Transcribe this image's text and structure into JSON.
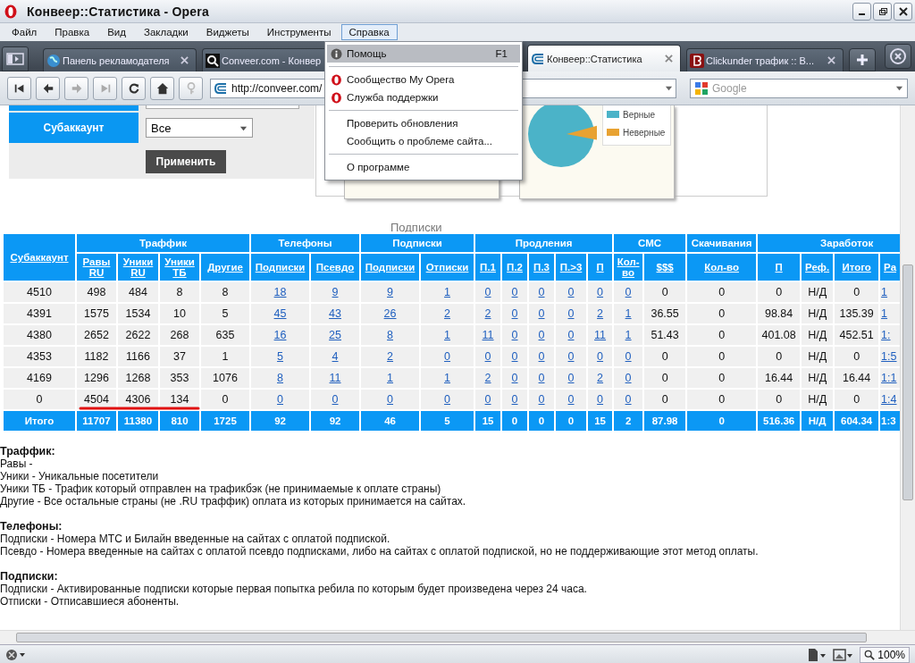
{
  "window": {
    "title": "Конвеер::Статистика - Opera"
  },
  "menu_bar": [
    {
      "label": "Файл",
      "selected": false
    },
    {
      "label": "Правка",
      "selected": false
    },
    {
      "label": "Вид",
      "selected": false
    },
    {
      "label": "Закладки",
      "selected": false
    },
    {
      "label": "Виджеты",
      "selected": false
    },
    {
      "label": "Инструменты",
      "selected": false
    },
    {
      "label": "Справка",
      "selected": true
    }
  ],
  "help_menu": [
    {
      "kind": "help",
      "label": "Помощь",
      "shortcut": "F1",
      "selected": true
    },
    {
      "kind": "separator"
    },
    {
      "kind": "opera",
      "label": "Сообщество My Opera",
      "selected": false
    },
    {
      "kind": "opera",
      "label": "Служба поддержки",
      "selected": false
    },
    {
      "kind": "separator"
    },
    {
      "kind": "plain",
      "label": "Проверить обновления",
      "selected": false
    },
    {
      "kind": "plain",
      "label": "Сообщить о проблеме сайта...",
      "selected": false
    },
    {
      "kind": "separator"
    },
    {
      "kind": "plain",
      "label": "О программе",
      "selected": false
    }
  ],
  "tabs": [
    {
      "label": "Панель рекламодателя",
      "selected": false,
      "close_button": true
    },
    {
      "label": "Conveer.com - Конвер",
      "selected": false
    },
    {
      "label": "Конвеер::Статистика",
      "selected": true,
      "close_button": true
    },
    {
      "label": "Clickunder трафик :: В...",
      "selected": false,
      "close_button": true
    }
  ],
  "address_bar": {
    "url": "http://conveer.com/"
  },
  "search": {
    "placeholder": "Google"
  },
  "filter_form": {
    "subaccount_label": "Субаккаунт",
    "subaccount_value": "Все",
    "apply_button": "Применить"
  },
  "charts": {
    "legend": [
      {
        "label": "Верные",
        "color": "#4bb3c8"
      },
      {
        "label": "Неверные",
        "color": "#e8a231"
      }
    ],
    "caption": "Подписки"
  },
  "table": {
    "key_column": "Субаккаунт",
    "groups": [
      {
        "label": "Траффик",
        "columns": [
          {
            "label": "Равы RU",
            "link": false
          },
          {
            "label": "Уники RU",
            "link": false
          },
          {
            "label": "Уники ТБ",
            "link": false
          },
          {
            "label": "Другие",
            "link": false
          }
        ]
      },
      {
        "label": "Телефоны",
        "columns": [
          {
            "label": "Подписки",
            "link": true
          },
          {
            "label": "Псевдо",
            "link": true
          }
        ]
      },
      {
        "label": "Подписки",
        "columns": [
          {
            "label": "Подписки",
            "link": true
          },
          {
            "label": "Отписки",
            "link": true
          }
        ]
      },
      {
        "label": "Продления",
        "columns": [
          {
            "label": "П.1",
            "link": true
          },
          {
            "label": "П.2",
            "link": true
          },
          {
            "label": "П.3",
            "link": true
          },
          {
            "label": "П.>3",
            "link": true
          },
          {
            "label": "П",
            "link": true
          }
        ]
      },
      {
        "label": "СМС",
        "columns": [
          {
            "label": "Кол-во",
            "link": true
          },
          {
            "label": "$$$",
            "link": false
          }
        ]
      },
      {
        "label": "Скачивания",
        "columns": [
          {
            "label": "Кол-во",
            "link": false
          }
        ]
      },
      {
        "label": "Заработок",
        "columns": [
          {
            "label": "П",
            "link": false
          },
          {
            "label": "Реф.",
            "link": false
          },
          {
            "label": "Итого",
            "link": false
          },
          {
            "label": "Ра",
            "link": true
          }
        ]
      }
    ],
    "rows": [
      {
        "subaccount": "4510",
        "underlined": false,
        "cells": [
          "498",
          "484",
          "8",
          "8",
          "18",
          "9",
          "9",
          "1",
          "0",
          "0",
          "0",
          "0",
          "0",
          "0",
          "0",
          "0",
          "0",
          "Н/Д",
          "0",
          "1"
        ]
      },
      {
        "subaccount": "4391",
        "underlined": false,
        "cells": [
          "1575",
          "1534",
          "10",
          "5",
          "45",
          "43",
          "26",
          "2",
          "2",
          "0",
          "0",
          "0",
          "2",
          "1",
          "36.55",
          "0",
          "98.84",
          "Н/Д",
          "135.39",
          "1"
        ]
      },
      {
        "subaccount": "4380",
        "underlined": false,
        "cells": [
          "2652",
          "2622",
          "268",
          "635",
          "16",
          "25",
          "8",
          "1",
          "11",
          "0",
          "0",
          "0",
          "11",
          "1",
          "51.43",
          "0",
          "401.08",
          "Н/Д",
          "452.51",
          "1:"
        ]
      },
      {
        "subaccount": "4353",
        "underlined": false,
        "cells": [
          "1182",
          "1166",
          "37",
          "1",
          "5",
          "4",
          "2",
          "0",
          "0",
          "0",
          "0",
          "0",
          "0",
          "0",
          "0",
          "0",
          "0",
          "Н/Д",
          "0",
          "1:5"
        ]
      },
      {
        "subaccount": "4169",
        "underlined": false,
        "cells": [
          "1296",
          "1268",
          "353",
          "1076",
          "8",
          "11",
          "1",
          "1",
          "2",
          "0",
          "0",
          "0",
          "2",
          "0",
          "0",
          "0",
          "16.44",
          "Н/Д",
          "16.44",
          "1:1"
        ]
      },
      {
        "subaccount": "0",
        "underlined": true,
        "cells": [
          "4504",
          "4306",
          "134",
          "0",
          "0",
          "0",
          "0",
          "0",
          "0",
          "0",
          "0",
          "0",
          "0",
          "0",
          "0",
          "0",
          "0",
          "Н/Д",
          "0",
          "1:4"
        ]
      }
    ],
    "total": {
      "label": "Итого",
      "cells": [
        "11707",
        "11380",
        "810",
        "1725",
        "92",
        "92",
        "46",
        "5",
        "15",
        "0",
        "0",
        "0",
        "15",
        "2",
        "87.98",
        "0",
        "516.36",
        "Н/Д",
        "604.34",
        "1:3"
      ]
    }
  },
  "notes": [
    {
      "heading": "Траффик:",
      "lines": [
        "Равы -",
        "Уники - Уникальные посетители",
        "Уники ТБ - Трафик который отправлен на трафикбэк (не принимаемые к оплате страны)",
        "Другие - Все остальные страны (не .RU траффик) оплата из которых принимается на сайтах."
      ]
    },
    {
      "heading": "Телефоны:",
      "lines": [
        "Подписки - Номера МТС и Билайн введенные на сайтах с оплатой подпиской.",
        "Псевдо - Номера введенные на сайтах с оплатой псевдо подписками, либо на сайтах с оплатой подпиской, но не поддерживающие этот метод оплаты."
      ]
    },
    {
      "heading": "Подписки:",
      "lines": [
        "Подписки - Активированные подписки которые первая попытка ребила по которым будет произведена через 24 часа.",
        "Отписки - Отписавшиеся абоненты."
      ]
    }
  ],
  "status_bar": {
    "zoom": "100%"
  }
}
